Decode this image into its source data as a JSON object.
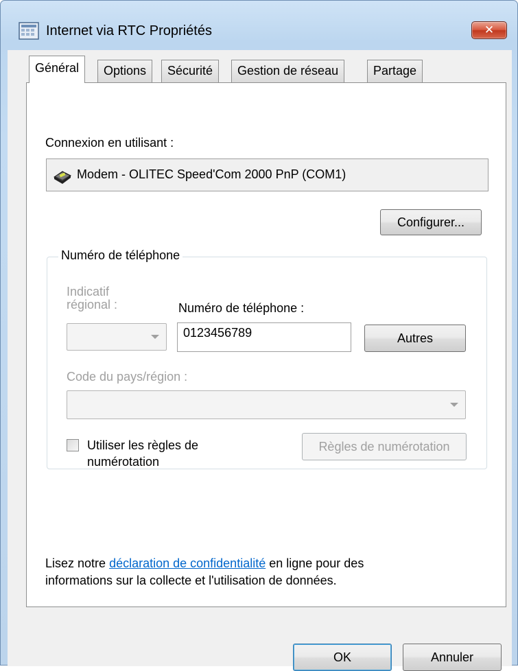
{
  "window": {
    "title": "Internet via RTC Propriétés",
    "close_label": "✕"
  },
  "tabs": [
    {
      "label": "Général",
      "active": true
    },
    {
      "label": "Options",
      "active": false
    },
    {
      "label": "Sécurité",
      "active": false
    },
    {
      "label": "Gestion de réseau",
      "active": false
    },
    {
      "label": "Partage",
      "active": false
    }
  ],
  "general": {
    "connect_using_label": "Connexion en utilisant :",
    "device_name": "Modem - OLITEC Speed'Com 2000 PnP (COM1)",
    "configure_button": "Configurer...",
    "phone_group": {
      "legend": "Numéro de téléphone",
      "area_code_label": "Indicatif régional :",
      "area_code_value": "",
      "phone_number_label": "Numéro de téléphone :",
      "phone_number_value": "0123456789",
      "alternates_button": "Autres",
      "country_label": "Code du pays/région :",
      "country_value": "",
      "use_dialing_rules_label": "Utiliser les règles de numérotation",
      "use_dialing_rules_checked": false,
      "dialing_rules_button": "Règles de numérotation"
    },
    "privacy": {
      "text_before": "Lisez notre ",
      "link_text": "déclaration de confidentialité",
      "text_after": " en ligne pour des informations sur la collecte et l'utilisation de données."
    }
  },
  "footer": {
    "ok_button": "OK",
    "cancel_button": "Annuler"
  },
  "icons": {
    "title": "network-connection-icon",
    "device": "modem-icon",
    "close": "close-icon",
    "dropdown": "chevron-down-icon"
  },
  "colors": {
    "link": "#0066cc",
    "close_button": "#c7442a",
    "disabled_text": "#a0a0a0"
  }
}
